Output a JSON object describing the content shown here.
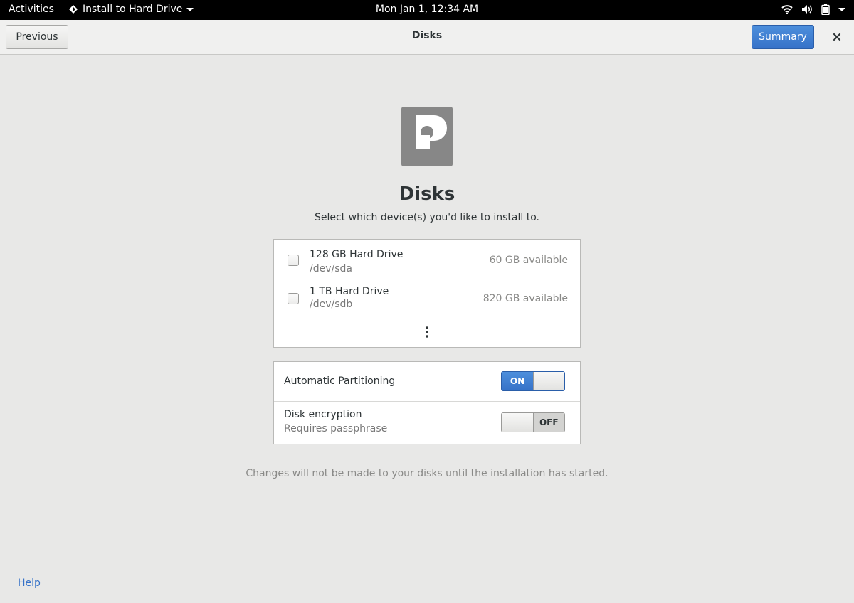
{
  "topbar": {
    "activities": "Activities",
    "app_menu": "Install to Hard Drive",
    "clock": "Mon Jan 1, 12:34 AM",
    "icons": [
      "wifi-icon",
      "volume-icon",
      "battery-icon",
      "chevron-down-icon"
    ]
  },
  "header": {
    "previous_label": "Previous",
    "title": "Disks",
    "summary_label": "Summary",
    "close_symbol": "✕"
  },
  "page": {
    "heading": "Disks",
    "subtitle": "Select which device(s) you'd like to install to."
  },
  "disks": [
    {
      "name": "128 GB Hard Drive",
      "device": "/dev/sda",
      "available": "60 GB available",
      "checked": false
    },
    {
      "name": "1 TB Hard Drive",
      "device": "/dev/sdb",
      "available": "820 GB available",
      "checked": false
    }
  ],
  "more_symbol": "⋮",
  "options": {
    "auto_partitioning": {
      "label": "Automatic Partitioning",
      "state": "ON"
    },
    "encryption": {
      "label": "Disk encryption",
      "sublabel": "Requires passphrase",
      "state": "OFF"
    }
  },
  "footer_note": "Changes will not be made to your disks until the installation has started.",
  "help": "Help",
  "colors": {
    "accent": "#3672c8",
    "topbar": "#000000",
    "background": "#e8e8e7"
  }
}
